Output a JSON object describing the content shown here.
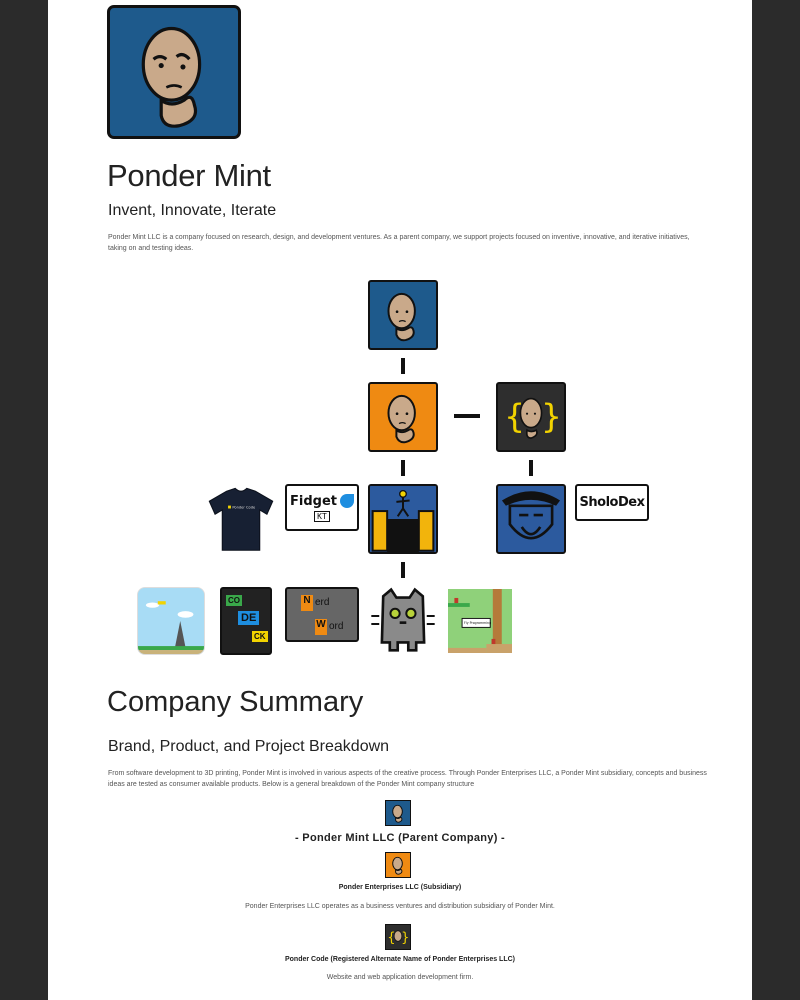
{
  "header": {
    "title": "Ponder Mint",
    "subtitle": "Invent, Innovate, Iterate",
    "intro": "Ponder Mint LLC is a company focused on research, design, and development ventures. As a parent company, we support projects focused on inventive, innovative, and iterative initiatives, taking on and testing ideas."
  },
  "tree": {
    "fidget_label": "Fidget",
    "fidget_sub": "KT",
    "sholo_label": "SholoDex",
    "codeck": [
      "CO",
      "DE",
      "CK"
    ],
    "nerd_word": [
      "N",
      "erd",
      "W",
      "ord"
    ],
    "shirt_text": "Ponder Code",
    "game_sign": "Fly Programming"
  },
  "summary": {
    "title": "Company Summary",
    "subtitle": "Brand, Product, and Project Breakdown",
    "intro": "From software development to 3D printing, Ponder Mint is involved in various aspects of the creative process. Through Ponder Enterprises LLC, a Ponder Mint subsidiary, concepts and business ideas are tested as consumer available products. Below is a general breakdown of the Ponder Mint company structure",
    "items": [
      {
        "name": "- Ponder Mint LLC (Parent Company) -",
        "desc": ""
      },
      {
        "name": "Ponder Enterprises LLC (Subsidiary)",
        "desc": "Ponder Enterprises LLC operates as a business ventures and distribution subsidiary of Ponder Mint."
      },
      {
        "name": "Ponder Code (Registered Alternate Name of Ponder Enterprises LLC)",
        "desc": "Website and web application development firm."
      }
    ]
  },
  "colors": {
    "blue": "#1e5a8c",
    "orange": "#ef8a12",
    "dark": "#2e2e2e",
    "skin": "#c9a98a"
  }
}
